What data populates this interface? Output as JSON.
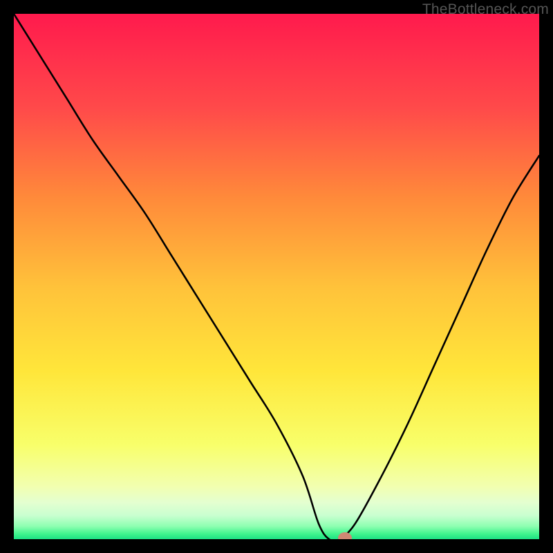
{
  "watermark": "TheBottleneck.com",
  "chart_data": {
    "type": "line",
    "title": "",
    "xlabel": "",
    "ylabel": "",
    "xlim": [
      0,
      100
    ],
    "ylim": [
      0,
      100
    ],
    "series": [
      {
        "name": "bottleneck-curve",
        "x": [
          0,
          5,
          10,
          15,
          20,
          25,
          30,
          35,
          40,
          45,
          50,
          55,
          58,
          60,
          62,
          65,
          70,
          75,
          80,
          85,
          90,
          95,
          100
        ],
        "y": [
          100,
          92,
          84,
          76,
          69,
          62,
          54,
          46,
          38,
          30,
          22,
          12,
          3,
          0,
          0,
          3,
          12,
          22,
          33,
          44,
          55,
          65,
          73
        ]
      }
    ],
    "marker": {
      "x": 63,
      "y": 0,
      "label": "optimal-point"
    },
    "gradient_stops": [
      {
        "offset": 0.0,
        "color": "#ff1a4d"
      },
      {
        "offset": 0.18,
        "color": "#ff4a4a"
      },
      {
        "offset": 0.35,
        "color": "#ff8a3a"
      },
      {
        "offset": 0.52,
        "color": "#ffc23a"
      },
      {
        "offset": 0.68,
        "color": "#ffe63a"
      },
      {
        "offset": 0.82,
        "color": "#f8ff6a"
      },
      {
        "offset": 0.9,
        "color": "#f2ffb0"
      },
      {
        "offset": 0.93,
        "color": "#e4ffd0"
      },
      {
        "offset": 0.955,
        "color": "#c9ffd0"
      },
      {
        "offset": 0.975,
        "color": "#8fffb2"
      },
      {
        "offset": 0.99,
        "color": "#40f58d"
      },
      {
        "offset": 1.0,
        "color": "#1de084"
      }
    ]
  }
}
